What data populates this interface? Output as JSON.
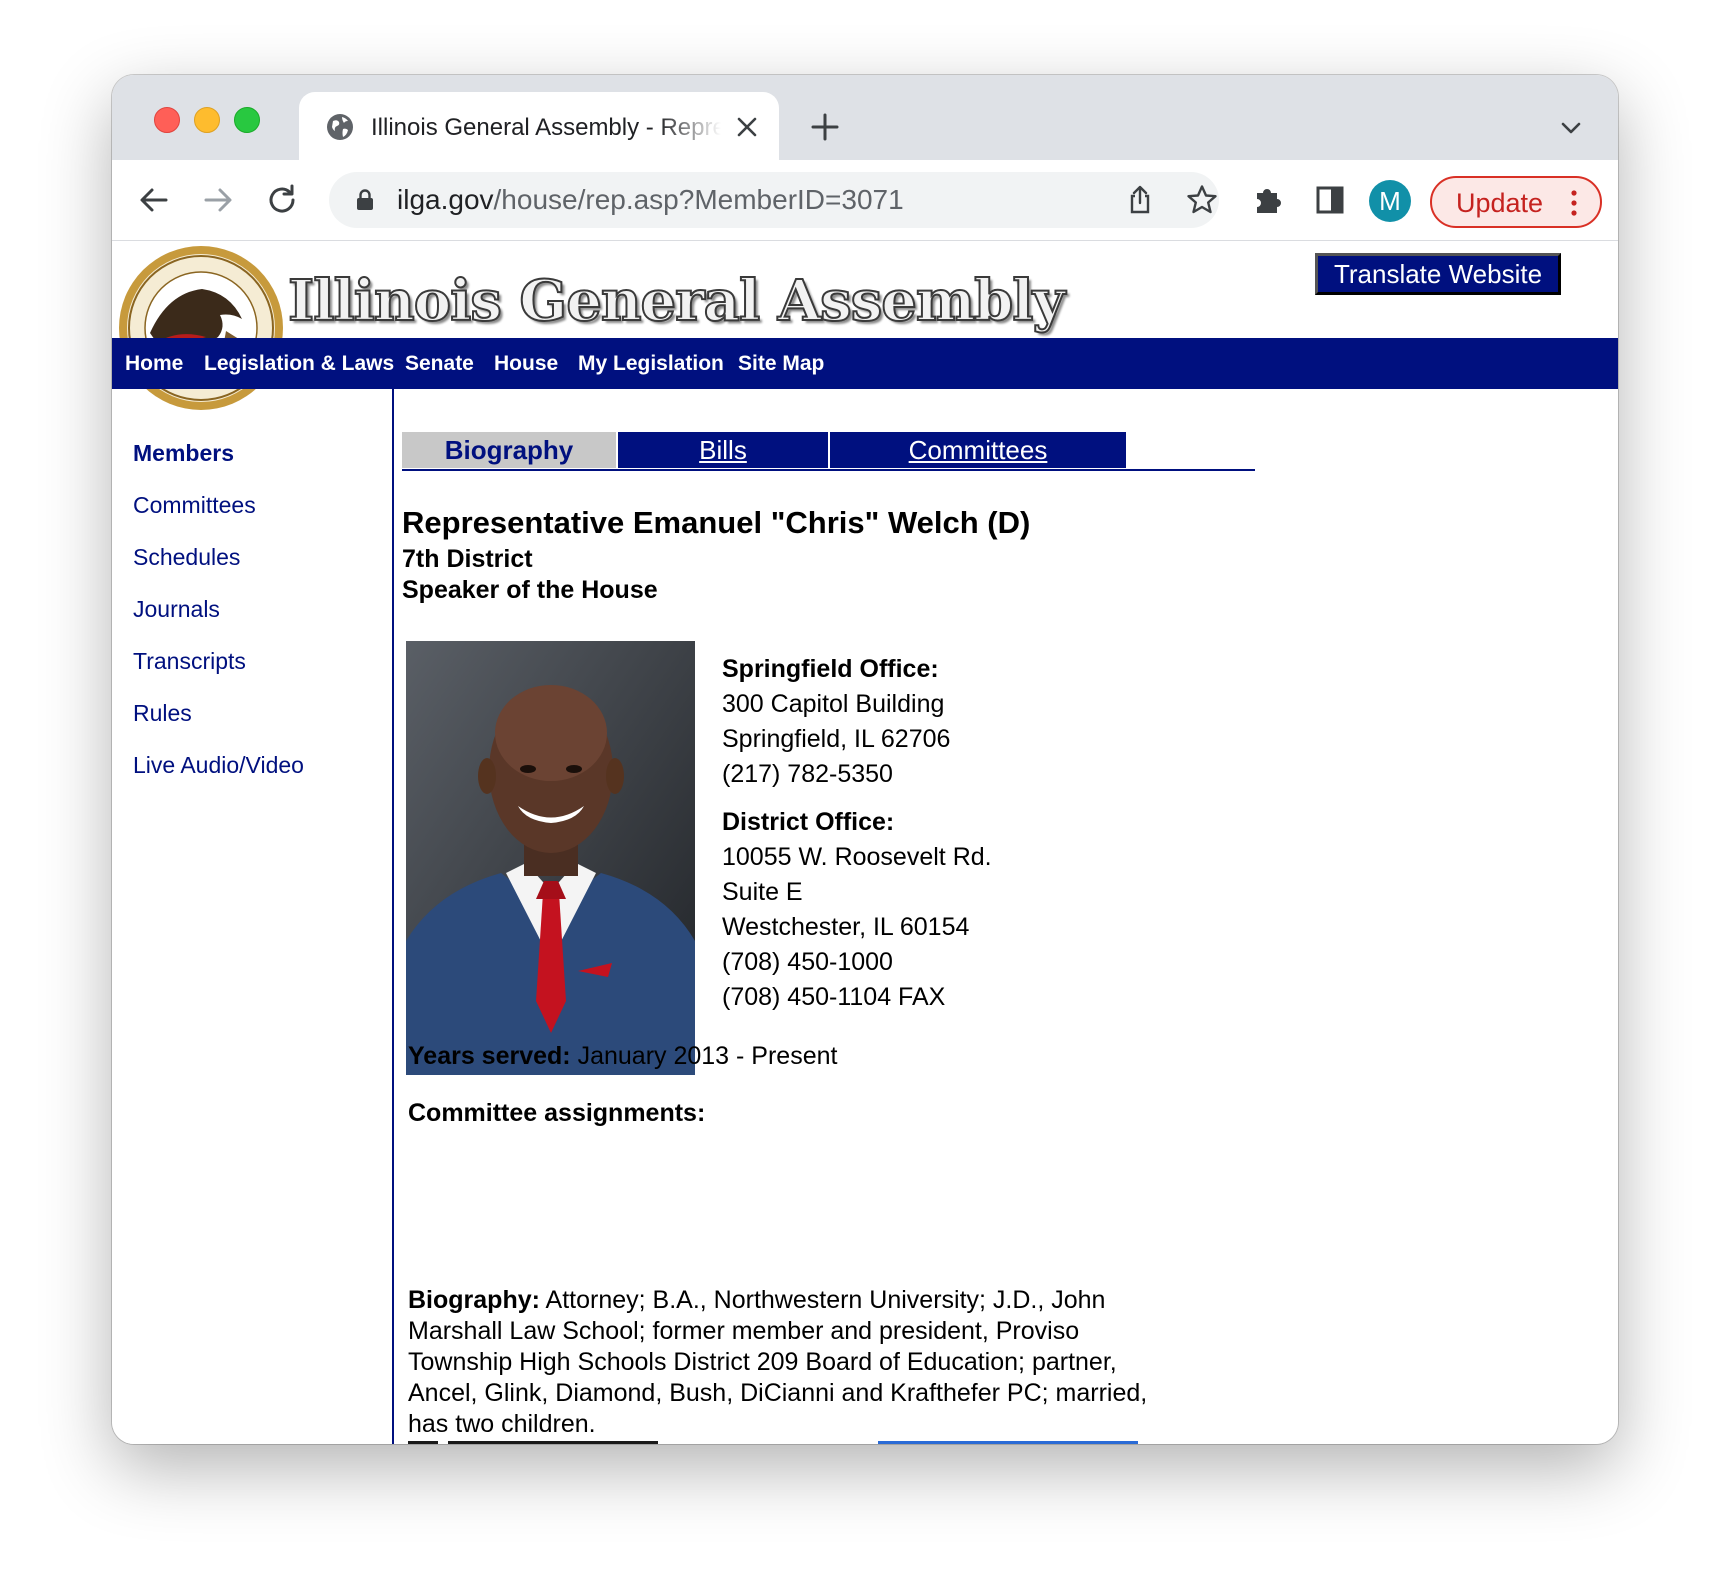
{
  "browser": {
    "tab_title": "Illinois General Assembly - Representative Biography",
    "url_host": "ilga.gov",
    "url_path": "/house/rep.asp?MemberID=3071",
    "profile_initial": "M",
    "update_label": "Update"
  },
  "site": {
    "logo_text": "Illinois General Assembly",
    "translate_label": "Translate Website",
    "topnav": [
      "Home",
      "Legislation & Laws",
      "Senate",
      "House",
      "My Legislation",
      "Site Map"
    ],
    "sidenav": [
      "Members",
      "Committees",
      "Schedules",
      "Journals",
      "Transcripts",
      "Rules",
      "Live Audio/Video"
    ]
  },
  "tabs": [
    "Biography",
    "Bills",
    "Committees"
  ],
  "member": {
    "name": "Representative Emanuel \"Chris\" Welch (D)",
    "district": "7th District",
    "title": "Speaker of the House",
    "springfield_heading": "Springfield Office:",
    "springfield_lines": [
      "300 Capitol Building",
      "Springfield, IL   62706",
      "(217) 782-5350"
    ],
    "district_heading": "District Office:",
    "district_lines": [
      "10055 W. Roosevelt Rd.",
      "Suite E",
      "Westchester, IL  60154",
      "(708) 450-1000",
      "(708) 450-1104 FAX"
    ],
    "years_label": "Years served:",
    "years_value": "January 2013 - Present",
    "committee_label": "Committee assignments:",
    "bio_label": "Biography:",
    "bio_text": "Attorney; B.A., Northwestern University; J.D., John Marshall Law School; former member and president, Proviso Township High Schools District 209 Board of Education; partner, Ancel, Glink, Diamond, Bush, DiCianni and Krafthefer PC; married, has two children."
  },
  "colors": {
    "brand_navy": "#00107f",
    "update_red": "#c5221f",
    "avatar_teal": "#1190a8"
  }
}
